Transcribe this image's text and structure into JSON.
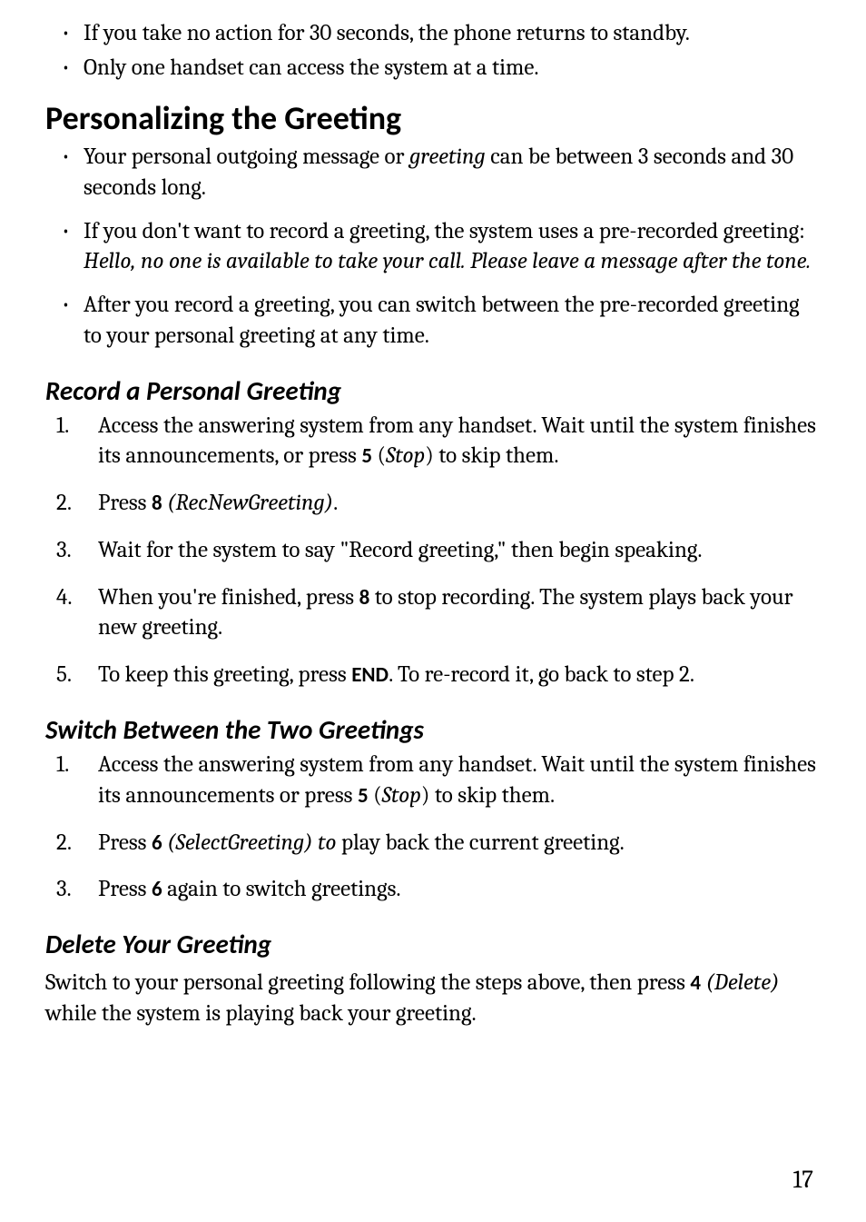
{
  "top_bullets": [
    "If you take no action for 30 seconds, the phone returns to standby.",
    "Only one handset can access the system at a time."
  ],
  "heading1": "Personalizing the Greeting",
  "greeting_bullets": {
    "b1_pre": "Your personal outgoing message or ",
    "b1_em": "greeting",
    "b1_post": " can be between 3 seconds and 30 seconds long.",
    "b2_pre": "If you don't want to record a greeting, the system uses a pre-recorded greeting: ",
    "b2_em": "Hello, no one is available to take your call. Please leave a message after the tone.",
    "b3": "After you record a greeting, you can switch between the pre-recorded greeting to your personal greeting at any time."
  },
  "record_heading": "Record a Personal Greeting",
  "record_steps": {
    "s1_pre": "Access the answering system from any handset. Wait until the system finishes its announcements, or press ",
    "s1_key": "5",
    "s1_mid1": " (",
    "s1_em": "Stop",
    "s1_post": ") to skip them.",
    "s2_pre": "Press ",
    "s2_key": "8",
    "s2_mid": " ",
    "s2_em": "(RecNewGreeting)",
    "s2_post": ".",
    "s3": "Wait for the system to say \"Record greeting,\" then begin speaking.",
    "s4_pre": "When you're finished, press ",
    "s4_key": "8",
    "s4_post": " to stop recording. The system plays back your new greeting.",
    "s5_pre": "To keep this greeting, press ",
    "s5_key": "END",
    "s5_post": ". To re-record it, go back to step 2."
  },
  "switch_heading": "Switch Between the Two Greetings",
  "switch_steps": {
    "s1_pre": "Access the answering system from any handset. Wait until the system finishes its announcements or press ",
    "s1_key": "5",
    "s1_mid1": " (",
    "s1_em": "Stop",
    "s1_post": ") to skip them.",
    "s2_pre": "Press ",
    "s2_key": "6",
    "s2_mid": " ",
    "s2_em": "(SelectGreeting) to",
    "s2_post": " play back the current greeting.",
    "s3_pre": "Press ",
    "s3_key": "6",
    "s3_post": " again to switch greetings."
  },
  "delete_heading": "Delete Your Greeting",
  "delete_para": {
    "pre": "Switch to your personal greeting following the steps above, then press ",
    "key": "4",
    "mid": " ",
    "em": "(Delete)",
    "post": " while the system is playing back your greeting."
  },
  "page_number": "17"
}
